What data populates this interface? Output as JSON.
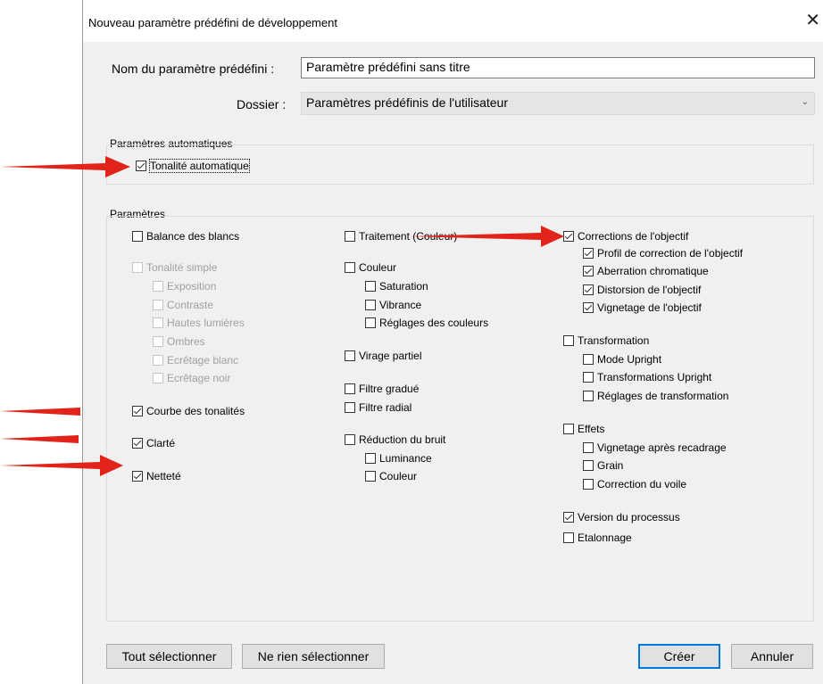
{
  "dialog": {
    "title": "Nouveau paramètre prédéfini de développement",
    "close_glyph": "✕",
    "preset_name_label": "Nom du paramètre prédéfini :",
    "preset_name_value": "Paramètre prédéfini sans titre",
    "folder_label": "Dossier :",
    "folder_value": "Paramètres prédéfinis de l'utilisateur"
  },
  "auto_settings": {
    "label": "Paramètres automatiques",
    "auto_tone": {
      "label": "Tonalité automatique",
      "checked": true
    }
  },
  "settings": {
    "label": "Paramètres",
    "col1": {
      "white_balance": {
        "label": "Balance des blancs",
        "checked": false
      },
      "basic_tone": {
        "label": "Tonalité simple",
        "checked": false,
        "disabled": true
      },
      "exposure": {
        "label": "Exposition",
        "checked": false,
        "disabled": true
      },
      "contrast": {
        "label": "Contraste",
        "checked": false,
        "disabled": true
      },
      "highlights": {
        "label": "Hautes lumières",
        "checked": false,
        "disabled": true
      },
      "shadows": {
        "label": "Ombres",
        "checked": false,
        "disabled": true
      },
      "white_clipping": {
        "label": "Ecrêtage blanc",
        "checked": false,
        "disabled": true
      },
      "black_clipping": {
        "label": "Ecrêtage noir",
        "checked": false,
        "disabled": true
      },
      "tone_curve": {
        "label": "Courbe des tonalités",
        "checked": true
      },
      "clarity": {
        "label": "Clarté",
        "checked": true
      },
      "sharpening": {
        "label": "Netteté",
        "checked": true
      }
    },
    "col2": {
      "treatment": {
        "label": "Traitement (Couleur)",
        "checked": false
      },
      "color": {
        "label": "Couleur",
        "checked": false
      },
      "saturation": {
        "label": "Saturation",
        "checked": false
      },
      "vibrance": {
        "label": "Vibrance",
        "checked": false
      },
      "color_adjustments": {
        "label": "Réglages des couleurs",
        "checked": false
      },
      "split_toning": {
        "label": "Virage partiel",
        "checked": false
      },
      "graduated_filter": {
        "label": "Filtre gradué",
        "checked": false
      },
      "radial_filter": {
        "label": "Filtre radial",
        "checked": false
      },
      "noise_reduction": {
        "label": "Réduction du bruit",
        "checked": false
      },
      "luminance": {
        "label": "Luminance",
        "checked": false
      },
      "color_noise": {
        "label": "Couleur",
        "checked": false
      }
    },
    "col3": {
      "lens_corrections": {
        "label": "Corrections de l'objectif",
        "checked": true
      },
      "lens_profile": {
        "label": "Profil de correction de l'objectif",
        "checked": true
      },
      "chromatic_aberration": {
        "label": "Aberration chromatique",
        "checked": true
      },
      "lens_distortion": {
        "label": "Distorsion de l'objectif",
        "checked": true
      },
      "lens_vignetting": {
        "label": "Vignetage de l'objectif",
        "checked": true
      },
      "transform": {
        "label": "Transformation",
        "checked": false
      },
      "upright_mode": {
        "label": "Mode Upright",
        "checked": false
      },
      "upright_transforms": {
        "label": "Transformations Upright",
        "checked": false
      },
      "transform_adjustments": {
        "label": "Réglages de transformation",
        "checked": false
      },
      "effects": {
        "label": "Effets",
        "checked": false
      },
      "post_crop_vignetting": {
        "label": "Vignetage après recadrage",
        "checked": false
      },
      "grain": {
        "label": "Grain",
        "checked": false
      },
      "dehaze": {
        "label": "Correction du voile",
        "checked": false
      },
      "process_version": {
        "label": "Version du processus",
        "checked": true
      },
      "calibration": {
        "label": "Etalonnage",
        "checked": false
      }
    }
  },
  "buttons": {
    "select_all": "Tout sélectionner",
    "select_none": "Ne rien sélectionner",
    "create": "Créer",
    "cancel": "Annuler"
  },
  "colors": {
    "annotation_arrow": "#e2231a",
    "primary_border": "#0078d7"
  }
}
